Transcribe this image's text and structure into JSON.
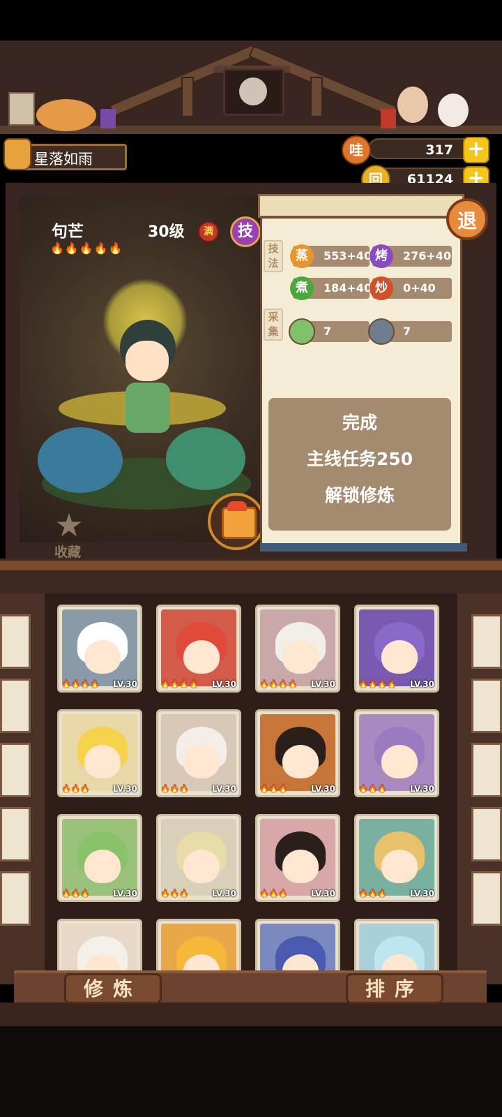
{
  "player": {
    "name": "星落如雨"
  },
  "resources": [
    {
      "name": "wa-token",
      "label": "哇",
      "value": "317",
      "color": "#e0762a"
    },
    {
      "name": "coin",
      "label": "回",
      "value": "61124",
      "color": "#e8b12a"
    }
  ],
  "exit_label": "退",
  "character": {
    "name": "句芒",
    "level": "30级",
    "max_badge": "满",
    "skill_label": "技",
    "flame_count": 5,
    "flames": "🔥🔥🔥🔥🔥"
  },
  "stats": {
    "technique_label": "技法",
    "gather_label": "采集",
    "techniques": [
      {
        "icon": "蒸",
        "value": "553+40",
        "color": "#e8952a"
      },
      {
        "icon": "烤",
        "value": "276+40",
        "color": "#8a4ac0"
      },
      {
        "icon": "煮",
        "value": "184+40",
        "color": "#4aa83a"
      },
      {
        "icon": "炒",
        "value": "0+40",
        "color": "#d0502a"
      }
    ],
    "gathering": [
      {
        "icon": "cabbage-icon",
        "value": "7",
        "color": "#7fc26a"
      },
      {
        "icon": "fish-icon",
        "value": "7",
        "color": "#6f7e8c"
      }
    ]
  },
  "locked": {
    "line1": "完成",
    "line2": "主线任务250",
    "line3": "解锁修炼"
  },
  "favorite_label": "收藏",
  "roster": [
    {
      "lv": "LV.30",
      "flames": "🔥🔥🔥🔥",
      "bg": "#8a9aa8",
      "hair": "#ffffff"
    },
    {
      "lv": "LV.30",
      "flames": "🔥🔥🔥🔥",
      "bg": "#d45a4a",
      "hair": "#e04a3a"
    },
    {
      "lv": "LV.30",
      "flames": "🔥🔥🔥🔥",
      "bg": "#c8a8a8",
      "hair": "#f2eeea"
    },
    {
      "lv": "LV.30",
      "flames": "🔥🔥🔥🔥",
      "bg": "#7a5ab0",
      "hair": "#8a6ac8"
    },
    {
      "lv": "LV.30",
      "flames": "🔥🔥🔥",
      "bg": "#e8d8a8",
      "hair": "#f5d24a"
    },
    {
      "lv": "LV.30",
      "flames": "🔥🔥🔥",
      "bg": "#d8c8b8",
      "hair": "#f4eee8"
    },
    {
      "lv": "LV.30",
      "flames": "🔥🔥🔥",
      "bg": "#c8753a",
      "hair": "#2a1f1a"
    },
    {
      "lv": "LV.30",
      "flames": "🔥🔥🔥",
      "bg": "#a88ac0",
      "hair": "#9a7ac0"
    },
    {
      "lv": "LV.30",
      "flames": "🔥🔥🔥",
      "bg": "#9ac27a",
      "hair": "#8ac26a"
    },
    {
      "lv": "LV.30",
      "flames": "🔥🔥🔥",
      "bg": "#d8d0b8",
      "hair": "#e8dca8"
    },
    {
      "lv": "LV.30",
      "flames": "🔥🔥🔥",
      "bg": "#d8a8a8",
      "hair": "#2a1f1a"
    },
    {
      "lv": "LV.30",
      "flames": "🔥🔥🔥",
      "bg": "#7ab0a0",
      "hair": "#e8c26a"
    },
    {
      "lv": "",
      "flames": "",
      "bg": "#e8d8c8",
      "hair": "#f4efe8"
    },
    {
      "lv": "",
      "flames": "",
      "bg": "#e8a84a",
      "hair": "#f5b83a"
    },
    {
      "lv": "",
      "flames": "",
      "bg": "#7a8ac0",
      "hair": "#4a5ab0"
    },
    {
      "lv": "",
      "flames": "",
      "bg": "#a8d0d8",
      "hair": "#bfe6ef"
    }
  ],
  "buttons": {
    "cultivate": "修炼",
    "sort": "排序"
  }
}
